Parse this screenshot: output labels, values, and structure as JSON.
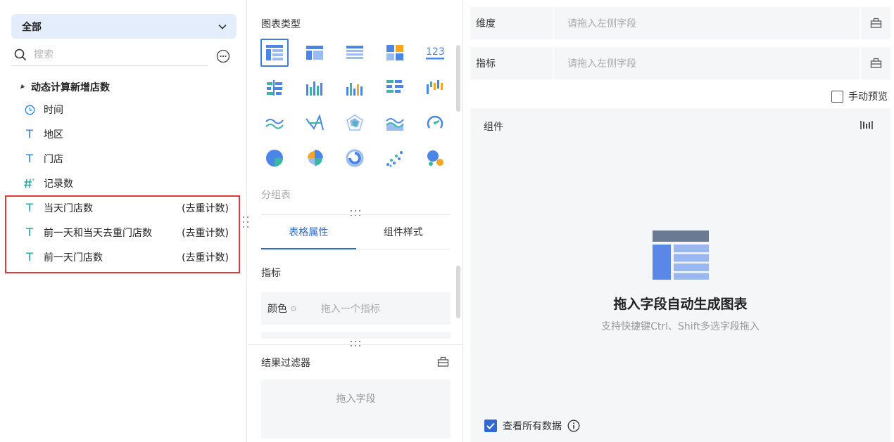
{
  "left": {
    "scope_label": "全部",
    "search_placeholder": "搜索",
    "dataset_name": "动态计算新增店数",
    "fields": [
      {
        "name": "时间",
        "type": "date",
        "agg": ""
      },
      {
        "name": "地区",
        "type": "text",
        "agg": ""
      },
      {
        "name": "门店",
        "type": "text",
        "agg": ""
      },
      {
        "name": "记录数",
        "type": "number",
        "agg": ""
      },
      {
        "name": "当天门店数",
        "type": "calc",
        "agg": "(去重计数)"
      },
      {
        "name": "前一天和当天去重门店数",
        "type": "calc",
        "agg": "(去重计数)"
      },
      {
        "name": "前一天门店数",
        "type": "calc",
        "agg": "(去重计数)"
      }
    ],
    "highlight_color": "#e1393a"
  },
  "middle": {
    "chart_type_title": "图表类型",
    "current_chart_type": "分组表",
    "tabs": [
      {
        "label": "表格属性",
        "active": true
      },
      {
        "label": "组件样式",
        "active": false
      }
    ],
    "metrics_label": "指标",
    "color_label": "颜色",
    "color_placeholder": "拖入一个指标",
    "filter_title": "结果过滤器",
    "filter_placeholder": "拖入字段"
  },
  "right": {
    "dimension_label": "维度",
    "dimension_placeholder": "请拖入左侧字段",
    "metric_label": "指标",
    "metric_placeholder": "请拖入左侧字段",
    "manual_preview_label": "手动预览",
    "manual_preview_checked": false,
    "component_label": "组件",
    "empty_title": "拖入字段自动生成图表",
    "empty_hint": "支持快捷键Ctrl、Shift多选字段拖入",
    "view_all_label": "查看所有数据",
    "view_all_checked": true
  },
  "colors": {
    "accent": "#2f6ad0",
    "icon_blue": "#4a86e8",
    "icon_teal": "#3ab5a8",
    "icon_orange": "#f5a623"
  }
}
